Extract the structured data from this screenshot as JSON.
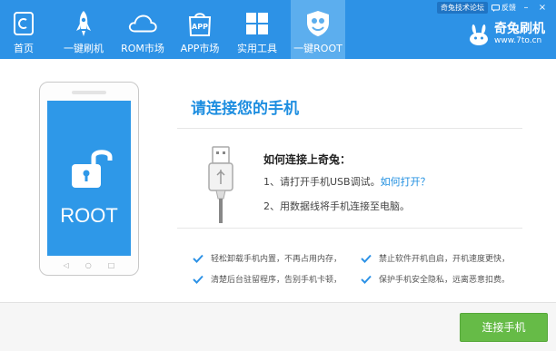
{
  "nav": {
    "items": [
      {
        "label": "首页",
        "icon": "home-icon"
      },
      {
        "label": "一键刷机",
        "icon": "rocket-icon"
      },
      {
        "label": "ROM市场",
        "icon": "cloud-icon"
      },
      {
        "label": "APP市场",
        "icon": "app-bag-icon"
      },
      {
        "label": "实用工具",
        "icon": "tools-grid-icon"
      },
      {
        "label": "一键ROOT",
        "icon": "root-shield-icon"
      }
    ],
    "active": "一键ROOT"
  },
  "top_links": {
    "forum": "奇兔技术论坛",
    "feedback": "反馈",
    "minimize": "–",
    "close": "×"
  },
  "brand": {
    "name": "奇兔刷机",
    "url": "www.7to.cn"
  },
  "phone": {
    "screen_label": "ROOT",
    "icon": "unlocked-padlock-icon"
  },
  "content": {
    "title": "请连接您的手机",
    "how_title": "如何连接上奇兔：",
    "step1": "1、请打开手机USB调试。",
    "step1_link": "如何打开？",
    "step2": "2、用数据线将手机连接至电脑。"
  },
  "features": [
    "轻松卸载手机内置，不再占用内存，",
    "禁止软件开机自启，开机速度更快，",
    "清楚后台驻留程序，告别手机卡顿，",
    "保护手机安全隐私，远离恶意扣费。"
  ],
  "footer": {
    "connect_label": "连接手机"
  },
  "colors": {
    "accent": "#2d92e6",
    "active_tab": "#5caeee",
    "button_green": "#66bb47"
  }
}
